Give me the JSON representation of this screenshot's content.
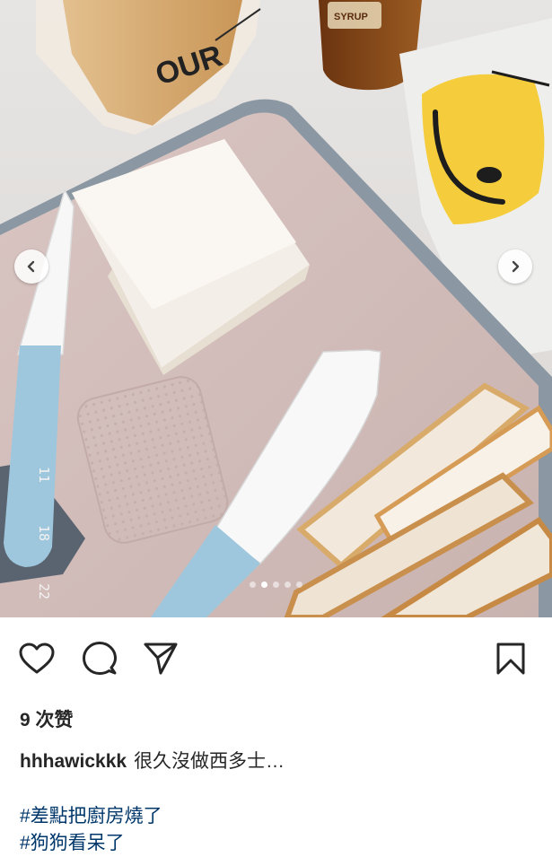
{
  "photo": {
    "packaging_text": "OUR",
    "bottle_label": "SYRUP",
    "timestamp_vertical": [
      "11",
      "18",
      "22"
    ],
    "carousel": {
      "total": 5,
      "active_index": 1
    }
  },
  "icons": {
    "prev": "chevron-left-icon",
    "next": "chevron-right-icon",
    "like": "heart-icon",
    "comment": "comment-icon",
    "share": "paper-plane-icon",
    "save": "bookmark-icon"
  },
  "post": {
    "likes_label": "9 次赞",
    "username": "hhhawickkk",
    "caption_text": "很久沒做西多士…",
    "hashtags": [
      "#差點把廚房燒了",
      "#狗狗看呆了"
    ]
  }
}
